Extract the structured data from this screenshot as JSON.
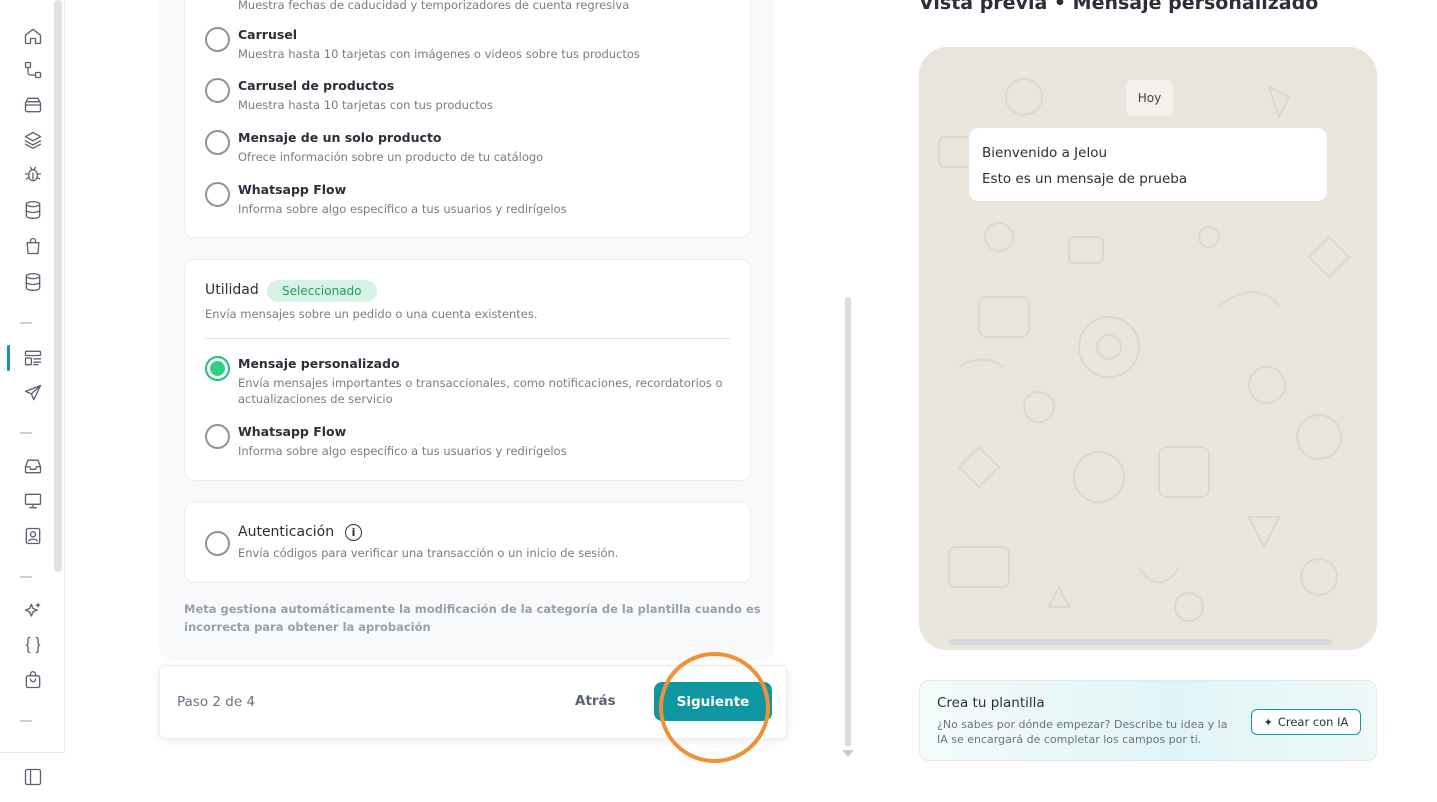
{
  "sidebar": {
    "icons": [
      "home-icon",
      "workflow-icon",
      "archive-icon",
      "layers-icon",
      "bug-icon",
      "database-icon",
      "shopping-bag-icon",
      "database-stack-icon",
      "templates-icon",
      "send-icon",
      "inbox-icon",
      "monitor-icon",
      "contacts-icon",
      "sparkles-icon",
      "braces-icon",
      "shop-icon",
      "sidebar-toggle-icon"
    ]
  },
  "marketing": {
    "top_desc": "Muestra fechas de caducidad y temporizadores de cuenta regresiva",
    "options": [
      {
        "title": "Carrusel",
        "desc": "Muestra hasta 10 tarjetas con imágenes o videos sobre tus productos"
      },
      {
        "title": "Carrusel de productos",
        "desc": "Muestra hasta 10 tarjetas con tus productos"
      },
      {
        "title": "Mensaje de un solo producto",
        "desc": "Ofrece información sobre un producto de tu catálogo"
      },
      {
        "title": "Whatsapp Flow",
        "desc": "Informa sobre algo específico a tus usuarios y redirígelos"
      }
    ]
  },
  "utility": {
    "title": "Utilidad",
    "badge": "Seleccionado",
    "desc": "Envía mensajes sobre un pedido o una cuenta existentes.",
    "options": [
      {
        "title": "Mensaje personalizado",
        "desc1": "Envía mensajes importantes o transaccionales, como notificaciones, recordatorios o",
        "desc2": "actualizaciones de servicio"
      },
      {
        "title": "Whatsapp Flow",
        "desc1": "Informa sobre algo específico a tus usuarios y redirígelos"
      }
    ]
  },
  "auth": {
    "title": "Autenticación",
    "desc": "Envía códigos para verificar una transacción o un inicio de sesión."
  },
  "note": {
    "line1": "Meta gestiona automáticamente la modificación de la categoría de la plantilla cuando es",
    "line2": "incorrecta para obtener la aprobación"
  },
  "footer": {
    "step": "Paso 2 de 4",
    "back": "Atrás",
    "next": "Siguiente"
  },
  "preview": {
    "title": "Vista previa • Mensaje personalizado",
    "day_chip": "Hoy",
    "message_title": "Bienvenido a Jelou",
    "message_body": "Esto es un mensaje de prueba"
  },
  "ai_card": {
    "title": "Crea tu plantilla",
    "desc": "¿No sabes por dónde empezar? Describe tu idea y la IA se encargará de completar los campos por ti.",
    "button": "Crear con IA"
  },
  "colors": {
    "accent": "#0e97a0",
    "selected": "#2fd07f",
    "badge_bg": "#d7f3e6",
    "badge_text": "#1e9e5e",
    "highlight": "#f0913a"
  }
}
